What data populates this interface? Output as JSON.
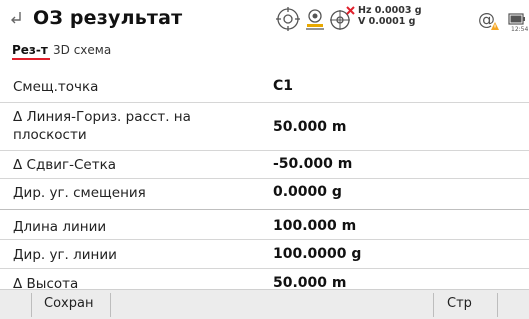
{
  "header": {
    "title": "ОЗ результат",
    "hz": "Hz 0.0003 g",
    "v": "V  0.0001 g",
    "clock": "12:54"
  },
  "tabs": [
    {
      "label": "Рез-т",
      "active": true
    },
    {
      "label": "3D схема",
      "active": false
    }
  ],
  "rows": [
    {
      "label": "Смещ.точка",
      "value": "C1"
    },
    {
      "label": "Δ Линия-Гориз. расст. на плоскости",
      "value": "50.000 m"
    },
    {
      "label": "Δ Сдвиг-Сетка",
      "value": "-50.000 m"
    },
    {
      "label": "Дир. уг. смещения",
      "value": "0.0000 g"
    },
    {
      "label": "Длина линии",
      "value": "100.000 m"
    },
    {
      "label": "Дир. уг. линии",
      "value": "100.0000 g"
    },
    {
      "label": "Δ Высота",
      "value": "50.000 m"
    }
  ],
  "toolbar": {
    "save_label": "Сохран",
    "page_label": "Стр"
  },
  "colors": {
    "accent": "#e0202c",
    "warning": "#f5a623"
  }
}
